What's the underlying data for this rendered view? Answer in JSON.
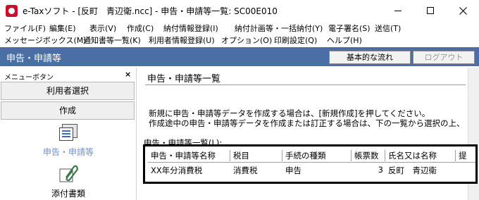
{
  "window": {
    "title": "e-Taxソフト - [反町　青辺衛.ncc] - 申告・申請等一覧: SC00E010"
  },
  "menubar": {
    "row1": [
      "ファイル(F)",
      "編集(E)",
      "表示(V)",
      "作成(C)",
      "納付情報登録(I)",
      "納付計画等・一括納付(Y)",
      "電子署名(S)",
      "送信(T)"
    ],
    "row2": [
      "メッセージボックス(M)",
      "通知書等一覧(K)",
      "利用者情報登録(U)",
      "オプション(O)",
      "印刷設定(Q)",
      "ヘルプ(H)"
    ]
  },
  "toolbar": {
    "section_title": "申告・申請等",
    "flow_button": "基本的な流れ",
    "logout_button": "ログアウト"
  },
  "sidebar": {
    "header": "メニューボタン",
    "close_glyph": "×",
    "user_select_button": "利用者選択",
    "create_button": "作成",
    "selected_item": "申告・申請等",
    "attach_item": "添付書類"
  },
  "main": {
    "title": "申告・申請等一覧",
    "desc1": "新規に申告・申請等データを作成する場合は、[新規作成]を押してください。",
    "desc2": "作成途中の申告・申請等データを作成または訂正する場合は、下の一覧から選択の上、",
    "list_label": "申告・申請等一覧(L):"
  },
  "table": {
    "columns": [
      "申告・申請等名称",
      "税目",
      "手続の種類",
      "帳票数",
      "氏名又は名称",
      "提"
    ],
    "rows": [
      [
        "XX年分消費税",
        "消費税",
        "申告",
        "3",
        "反町　青辺衛",
        ""
      ]
    ]
  },
  "colors": {
    "section_bar": "#4a6fa5",
    "selected_item_text": "#6f93cc",
    "highlight_frame": "#000000"
  },
  "icons": {
    "app": "etax-app-icon",
    "declaration": "document-stack-icon",
    "attachment": "paperclip-icon"
  }
}
